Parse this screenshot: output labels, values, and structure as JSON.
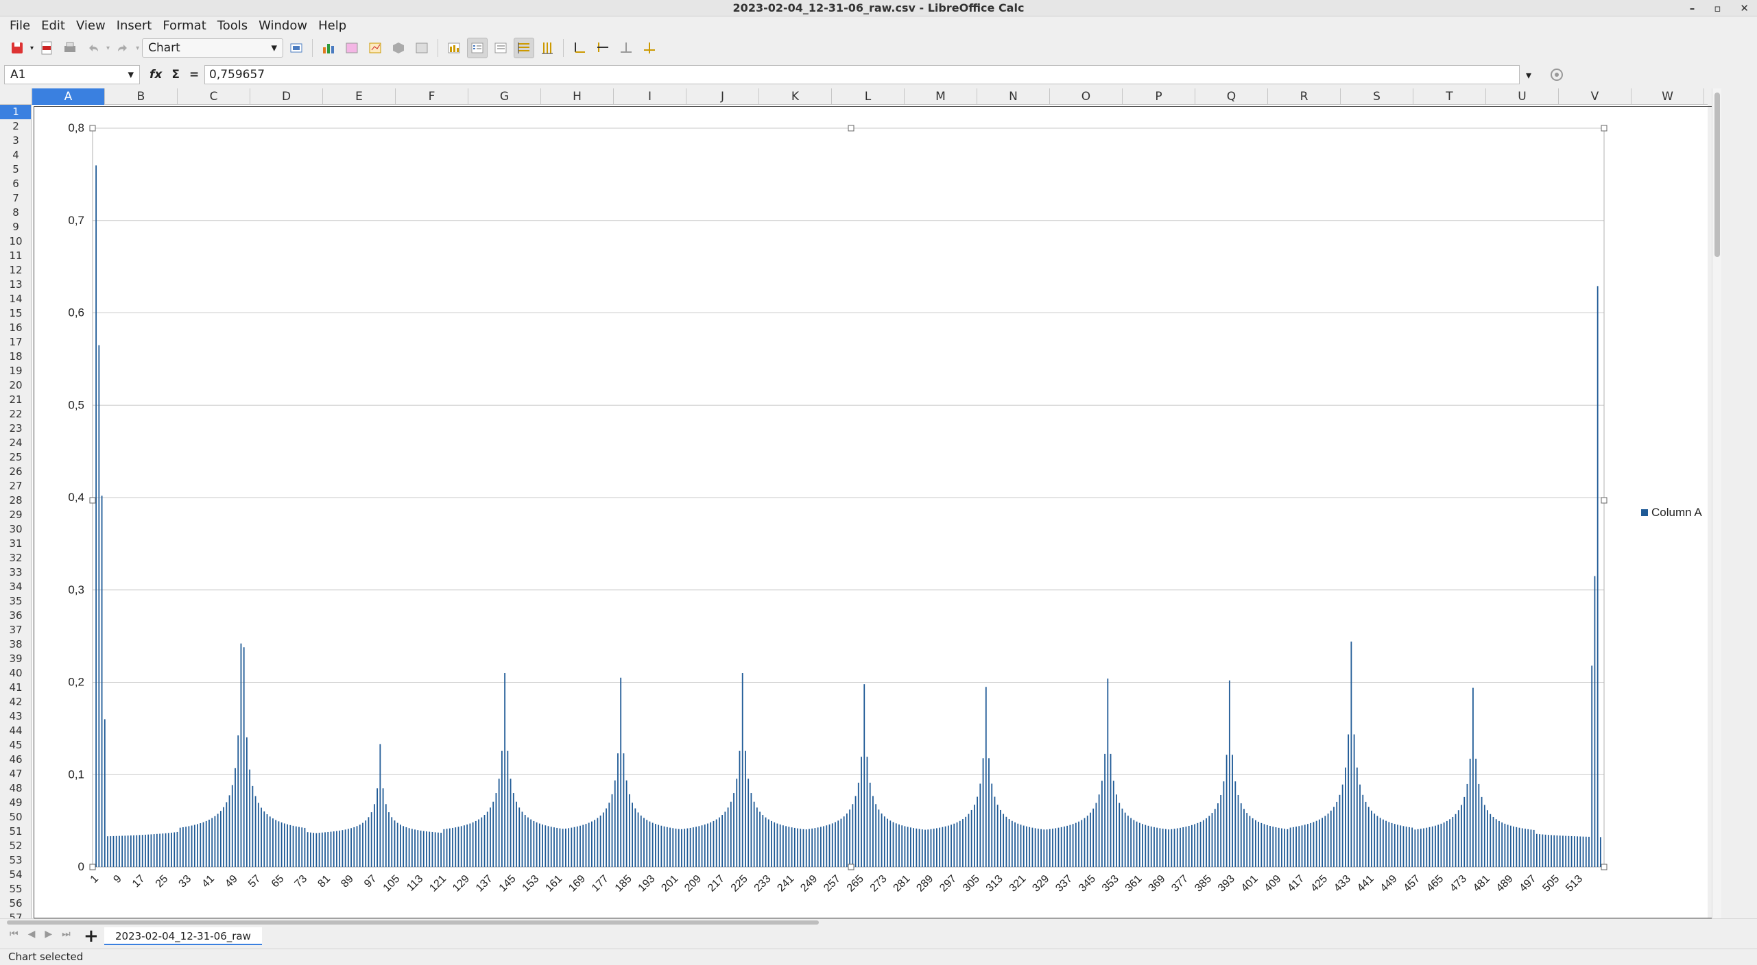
{
  "window": {
    "title": "2023-02-04_12-31-06_raw.csv - LibreOffice Calc",
    "controls": [
      "–",
      "▫",
      "✕"
    ]
  },
  "menu": {
    "items": [
      {
        "label": "File",
        "name": "menu-file"
      },
      {
        "label": "Edit",
        "name": "menu-edit"
      },
      {
        "label": "View",
        "name": "menu-view"
      },
      {
        "label": "Insert",
        "name": "menu-insert"
      },
      {
        "label": "Format",
        "name": "menu-format"
      },
      {
        "label": "Tools",
        "name": "menu-tools"
      },
      {
        "label": "Window",
        "name": "menu-window"
      },
      {
        "label": "Help",
        "name": "menu-help"
      }
    ]
  },
  "toolbar": {
    "chart_element_select": "Chart"
  },
  "formula_bar": {
    "name_box": "A1",
    "sum_symbol": "Σ",
    "equals_symbol": "=",
    "fx_symbol": "fx",
    "formula_value": "0,759657"
  },
  "columns": [
    "A",
    "B",
    "C",
    "D",
    "E",
    "F",
    "G",
    "H",
    "I",
    "J",
    "K",
    "L",
    "M",
    "N",
    "O",
    "P",
    "Q",
    "R",
    "S",
    "T",
    "U",
    "V",
    "W"
  ],
  "selected_column": "A",
  "selected_row": 1,
  "rows_visible": 57,
  "sheet": {
    "tab_label": "2023-02-04_12-31-06_raw"
  },
  "status": {
    "text": "Chart selected"
  },
  "colors": {
    "bar": "#1f5a96",
    "selection": "#3a80e0"
  },
  "chart_data": {
    "type": "bar",
    "title": "",
    "xlabel": "",
    "ylabel": "",
    "ylim": [
      0,
      0.8
    ],
    "yticks": [
      "0",
      "0,1",
      "0,2",
      "0,3",
      "0,4",
      "0,5",
      "0,6",
      "0,7",
      "0,8"
    ],
    "xticks": [
      "1",
      "9",
      "17",
      "25",
      "33",
      "41",
      "49",
      "57",
      "65",
      "73",
      "81",
      "89",
      "97",
      "105",
      "113",
      "121",
      "129",
      "137",
      "145",
      "153",
      "161",
      "169",
      "177",
      "185",
      "193",
      "201",
      "209",
      "217",
      "225",
      "233",
      "241",
      "249",
      "257",
      "265",
      "273",
      "281",
      "289",
      "297",
      "305",
      "313",
      "321",
      "329",
      "337",
      "345",
      "353",
      "361",
      "369",
      "377",
      "385",
      "393",
      "401",
      "409",
      "417",
      "425",
      "433",
      "441",
      "449",
      "457",
      "465",
      "473",
      "481",
      "489",
      "497",
      "505",
      "513"
    ],
    "grid": true,
    "legend_position": "right",
    "series": [
      {
        "name": "Column A",
        "count": 520,
        "values_description_peaks": [
          {
            "x": 1,
            "y": 0.759657
          },
          {
            "x": 2,
            "y": 0.565
          },
          {
            "x": 3,
            "y": 0.402
          },
          {
            "x": 4,
            "y": 0.16
          },
          {
            "x": 51,
            "y": 0.242
          },
          {
            "x": 52,
            "y": 0.238
          },
          {
            "x": 99,
            "y": 0.133
          },
          {
            "x": 142,
            "y": 0.21
          },
          {
            "x": 182,
            "y": 0.205
          },
          {
            "x": 224,
            "y": 0.21
          },
          {
            "x": 266,
            "y": 0.198
          },
          {
            "x": 308,
            "y": 0.195
          },
          {
            "x": 350,
            "y": 0.204
          },
          {
            "x": 392,
            "y": 0.202
          },
          {
            "x": 434,
            "y": 0.244
          },
          {
            "x": 476,
            "y": 0.194
          },
          {
            "x": 517,
            "y": 0.218
          },
          {
            "x": 518,
            "y": 0.315
          },
          {
            "x": 519,
            "y": 0.629
          }
        ],
        "baseline_min": 0.032
      }
    ]
  }
}
